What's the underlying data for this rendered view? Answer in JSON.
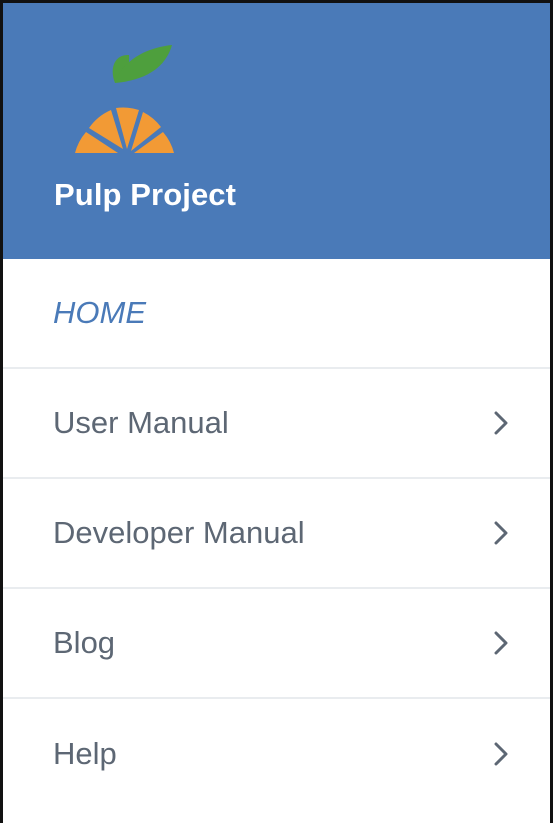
{
  "brand": {
    "title": "Pulp Project",
    "logo_icon": "orange-slice-with-leaf-icon",
    "header_color": "#4a7ab8",
    "orange_color": "#f29a35",
    "leaf_color": "#4e9f3d"
  },
  "nav": {
    "items": [
      {
        "label": "HOME",
        "active": true,
        "has_chevron": false
      },
      {
        "label": "User Manual",
        "active": false,
        "has_chevron": true,
        "icon": "chevron-right-icon"
      },
      {
        "label": "Developer Manual",
        "active": false,
        "has_chevron": true,
        "icon": "chevron-right-icon"
      },
      {
        "label": "Blog",
        "active": false,
        "has_chevron": true,
        "icon": "chevron-right-icon"
      },
      {
        "label": "Help",
        "active": false,
        "has_chevron": true,
        "icon": "chevron-right-icon"
      }
    ]
  }
}
